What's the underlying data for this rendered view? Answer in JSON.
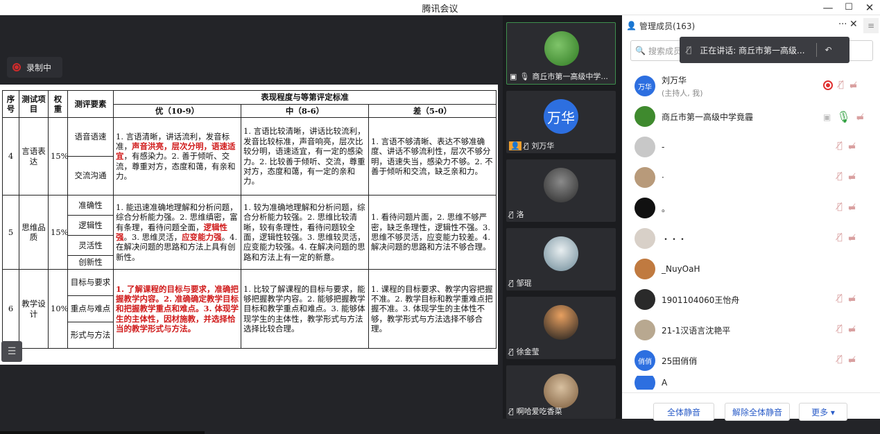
{
  "window": {
    "title": "腾讯会议",
    "min": "—",
    "max": "☐",
    "close": "✕"
  },
  "recording": {
    "label": "录制中"
  },
  "doc": {
    "headers": {
      "no": "序号",
      "item": "测试项目",
      "weight": "权重",
      "element": "测评要素",
      "standard": "表现程度与等第评定标准",
      "good": "优（10-9）",
      "mid": "中（8-6）",
      "poor": "差（5-0）"
    },
    "rows": [
      {
        "no": "4",
        "item": "言语表达",
        "weight": "15%",
        "elements": [
          "语音语速",
          "交流沟通"
        ],
        "good_a": "1. 言语清晰，讲话流利，发音标准，",
        "good_red1": "声音洪亮，层次分明，语速适宜",
        "good_b": "，有感染力。2. 善于倾听、交流，尊重对方，态度和蔼，有亲和力。",
        "mid": "1. 言语比较清晰，讲话比较流利，发音比较标准，声音响亮，层次比较分明，语速适宜，有一定的感染力。2. 比较善于倾听、交流，尊重对方，态度和蔼，有一定的亲和力。",
        "poor": "1. 言语不够清晰、表达不够准确度、讲话不够流利性，层次不够分明，语速失当，感染力不够。2. 不善于倾听和交流，缺乏亲和力。"
      },
      {
        "no": "5",
        "item": "思维品质",
        "weight": "15%",
        "elements": [
          "准确性",
          "逻辑性",
          "灵活性",
          "创新性"
        ],
        "good_a": "1. 能迅速准确地理解和分析问题，综合分析能力强。2. 思维缜密，富有条理，看待问题全面，",
        "good_red1": "逻辑性强",
        "good_b": "。3. 思维灵活，",
        "good_red2": "应变能力强",
        "good_c": "。4. 在解决问题的思路和方法上具有创新性。",
        "mid": "1. 较为准确地理解和分析问题，综合分析能力较强。2. 思维比较清晰，较有条理性，看待问题较全面，逻辑性较强。3. 思维较灵活，应变能力较强。4. 在解决问题的思路和方法上有一定的新意。",
        "poor": "1. 看待问题片面，2. 思维不够严密，缺乏条理性，逻辑性不强。3. 思维不够灵活，应变能力较差。4. 解决问题的思路和方法不够合理。"
      },
      {
        "no": "6",
        "item": "教学设计",
        "weight": "10%",
        "elements": [
          "目标与要求",
          "重点与难点",
          "形式与方法"
        ],
        "good_red1": "1. 了解课程的目标与要求，准确把握教学内容。2. 准确确定教学目标和把握教学重点和难点。3. 体现学生的主体性，因材施教，并选择恰当的教学形式与方法。",
        "mid": "1. 比较了解课程的目标与要求，能够把握教学内容。2. 能够把握教学目标和教学重点和难点。3. 能够体现学生的主体性，教学形式与方法选择比较合理。",
        "poor": "1. 课程的目标要求、教学内容把握不准。2. 教学目标和教学重难点把握不准。3. 体现学生的主体性不够，教学形式与方法选择不够合理。"
      }
    ]
  },
  "videos": [
    {
      "name": "商丘市第一高级中学...",
      "active": true
    },
    {
      "name": "刘万华",
      "avatar_text": "万华"
    },
    {
      "name": "洛"
    },
    {
      "name": "邹琨"
    },
    {
      "name": "徐金莹"
    },
    {
      "name": "啊哈爱吃香菜"
    }
  ],
  "panel": {
    "title": "管理成员(163)",
    "more": "···",
    "close": "✕",
    "side": "≡",
    "search_placeholder": "搜索成员",
    "speaking": "正在讲话: 商丘市第一高级...",
    "members": [
      {
        "name": "刘万华",
        "sub": "(主持人, 我)",
        "avatar_text": "万华",
        "color": "#2d6fe0"
      },
      {
        "name": "商丘市第一高级中学竟霾",
        "color": "#3f8a2e"
      },
      {
        "name": "-",
        "color": "#c8c8c8"
      },
      {
        "name": "·",
        "color": "#b89a7a"
      },
      {
        "name": "。",
        "color": "#111111"
      },
      {
        "name": "・・・",
        "color": "#d8d0c8"
      },
      {
        "name": "_NuyOaH",
        "color": "#c07a40"
      },
      {
        "name": "1901104060王怡舟",
        "color": "#2a2a2a"
      },
      {
        "name": "21-1汉语言沈艳平",
        "color": "#b8a890"
      },
      {
        "name": "25田俏俏",
        "avatar_text": "俏俏",
        "color": "#2d6fe0"
      },
      {
        "name": "A",
        "color": "#2d6fe0"
      }
    ],
    "footer": {
      "mute_all": "全体静音",
      "unmute_all": "解除全体静音",
      "more": "更多 ▾"
    }
  },
  "colors": {
    "accent": "#2a5cc8",
    "red": "#d01a1a",
    "bg": "#232428"
  }
}
